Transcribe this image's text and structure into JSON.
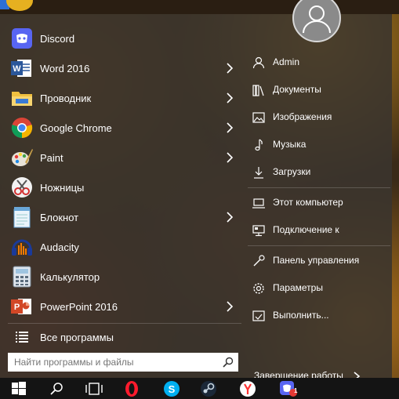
{
  "apps": [
    {
      "label": "Discord",
      "icon": "discord-icon",
      "submenu": false
    },
    {
      "label": "Word 2016",
      "icon": "word-icon",
      "submenu": true
    },
    {
      "label": "Проводник",
      "icon": "folder-icon",
      "submenu": true
    },
    {
      "label": "Google Chrome",
      "icon": "chrome-icon",
      "submenu": true
    },
    {
      "label": "Paint",
      "icon": "paint-icon",
      "submenu": true
    },
    {
      "label": "Ножницы",
      "icon": "scissors-icon",
      "submenu": false
    },
    {
      "label": "Блокнот",
      "icon": "notepad-icon",
      "submenu": true
    },
    {
      "label": "Audacity",
      "icon": "audacity-icon",
      "submenu": false
    },
    {
      "label": "Калькулятор",
      "icon": "calculator-icon",
      "submenu": false
    },
    {
      "label": "PowerPoint 2016",
      "icon": "powerpoint-icon",
      "submenu": true
    }
  ],
  "all_programs": "Все программы",
  "search": {
    "placeholder": "Найти программы и файлы"
  },
  "right_items": [
    {
      "label": "Admin",
      "icon": "user-icon"
    },
    {
      "label": "Документы",
      "icon": "documents-icon"
    },
    {
      "label": "Изображения",
      "icon": "pictures-icon"
    },
    {
      "label": "Музыка",
      "icon": "music-icon"
    },
    {
      "label": "Загрузки",
      "icon": "downloads-icon"
    },
    {
      "label": "Этот компьютер",
      "icon": "computer-icon"
    },
    {
      "label": "Подключение к",
      "icon": "connect-icon"
    },
    {
      "label": "Панель управления",
      "icon": "control-panel-icon"
    },
    {
      "label": "Параметры",
      "icon": "settings-icon"
    },
    {
      "label": "Выполнить...",
      "icon": "run-icon"
    }
  ],
  "shutdown_label": "Завершение работы",
  "taskbar": {
    "notification_badge": "1",
    "icons": [
      "windows-start-icon",
      "search-icon",
      "task-view-icon",
      "opera-icon",
      "skype-icon",
      "steam-icon",
      "yandex-icon",
      "discord-icon"
    ]
  },
  "colors": {
    "menu_bg": "#3a342e",
    "accent": "#2b6fd6",
    "text": "#ffffff"
  }
}
